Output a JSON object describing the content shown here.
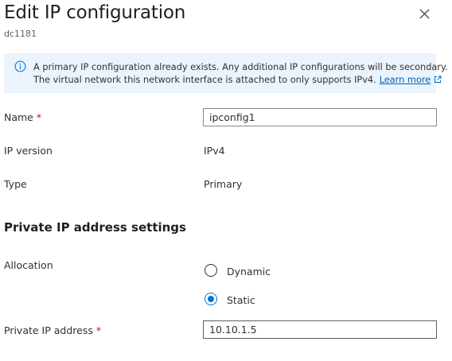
{
  "header": {
    "title": "Edit IP configuration",
    "subtitle": "dc1181",
    "close_icon": "close-icon"
  },
  "info_bar": {
    "icon": "info-icon",
    "line1": "A primary IP configuration already exists. Any additional IP configurations will be secondary.",
    "line2": "The virtual network this network interface is attached to only supports IPv4.",
    "link_label": "Learn more",
    "link_icon": "external-link-icon"
  },
  "form": {
    "name_label": "Name",
    "name_value": "ipconfig1",
    "required_marker": "*",
    "ip_version_label": "IP version",
    "ip_version_value": "IPv4",
    "type_label": "Type",
    "type_value": "Primary"
  },
  "private_ip": {
    "heading": "Private IP address settings",
    "allocation_label": "Allocation",
    "options": [
      {
        "label": "Dynamic",
        "selected": false
      },
      {
        "label": "Static",
        "selected": true
      }
    ],
    "address_label": "Private IP address",
    "address_value": "10.10.1.5"
  },
  "colors": {
    "accent": "#0078d4",
    "link": "#0066b4",
    "info_background": "#ebf3fc",
    "required": "#a4262c"
  }
}
